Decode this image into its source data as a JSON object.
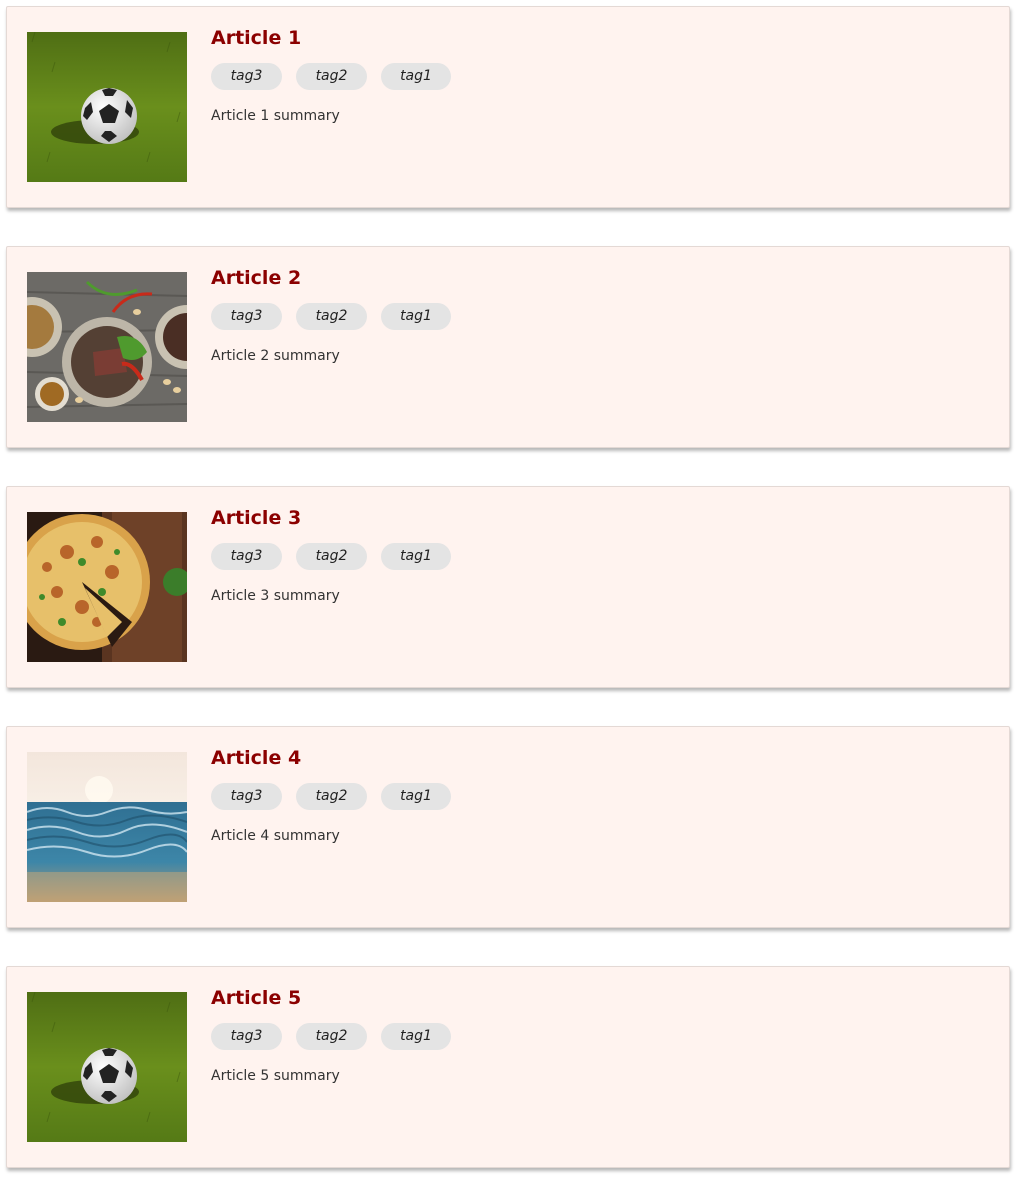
{
  "articles": [
    {
      "title": "Article 1",
      "tags": [
        "tag3",
        "tag2",
        "tag1"
      ],
      "summary": "Article 1 summary",
      "image": "soccer-ball-on-grass"
    },
    {
      "title": "Article 2",
      "tags": [
        "tag3",
        "tag2",
        "tag1"
      ],
      "summary": "Article 2 summary",
      "image": "food-plates-on-table"
    },
    {
      "title": "Article 3",
      "tags": [
        "tag3",
        "tag2",
        "tag1"
      ],
      "summary": "Article 3 summary",
      "image": "pizza-on-board"
    },
    {
      "title": "Article 4",
      "tags": [
        "tag3",
        "tag2",
        "tag1"
      ],
      "summary": "Article 4 summary",
      "image": "ocean-waves-sunset"
    },
    {
      "title": "Article 5",
      "tags": [
        "tag3",
        "tag2",
        "tag1"
      ],
      "summary": "Article 5 summary",
      "image": "soccer-ball-on-grass"
    }
  ],
  "colors": {
    "title": "#8b0000",
    "card_background": "#fff3ef",
    "tag_background": "#e4e4e4"
  }
}
